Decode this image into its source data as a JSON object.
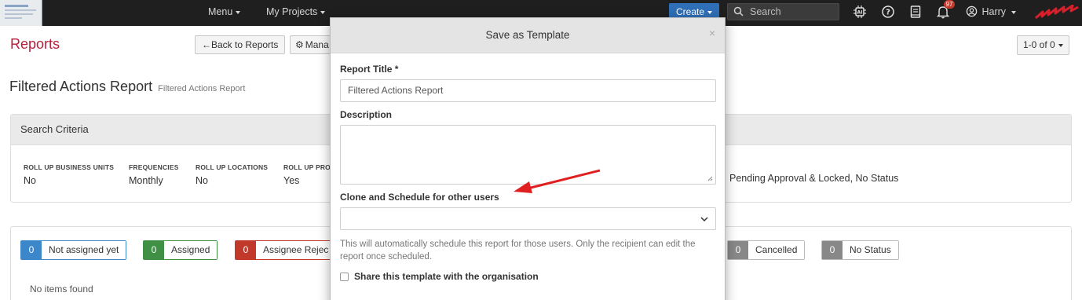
{
  "navbar": {
    "menu_label": "Menu",
    "projects_label": "My Projects",
    "create_label": "Create",
    "search_placeholder": "Search",
    "notifications_count": "97",
    "user_name": "Harry",
    "icons": [
      "cpu-icon",
      "help-icon",
      "book-icon",
      "bell-icon",
      "user-circle-icon"
    ]
  },
  "header": {
    "title": "Reports",
    "back_label": "Back to Reports",
    "manage_label": "Mana",
    "pager_label": "1-0 of 0"
  },
  "report": {
    "title": "Filtered Actions Report",
    "subtitle": "Filtered Actions Report"
  },
  "criteria": {
    "heading": "Search Criteria",
    "items": [
      {
        "label": "ROLL UP BUSINESS UNITS",
        "value": "No"
      },
      {
        "label": "FREQUENCIES",
        "value": "Monthly"
      },
      {
        "label": "ROLL UP LOCATIONS",
        "value": "No"
      },
      {
        "label": "ROLL UP PRO",
        "value": "Yes"
      }
    ],
    "status_value": "Pending Approval & Locked, No Status"
  },
  "statuses": [
    {
      "count": "0",
      "label": "Not assigned yet",
      "color": "#3c87c9"
    },
    {
      "count": "0",
      "label": "Assigned",
      "color": "#3f8f45"
    },
    {
      "count": "0",
      "label": "Assignee Rejec",
      "color": "#c0392b"
    },
    {
      "count": "0",
      "label": "Cancelled",
      "color": "#888888"
    },
    {
      "count": "0",
      "label": "No Status",
      "color": "#888888"
    }
  ],
  "empty_message": "No items found",
  "modal": {
    "title": "Save as Template",
    "close_symbol": "×",
    "report_title_label": "Report Title *",
    "report_title_value": "Filtered Actions Report",
    "description_label": "Description",
    "description_value": "",
    "clone_label": "Clone and Schedule for other users",
    "clone_value": "",
    "help_text": "This will automatically schedule this report for those users. Only the recipient can edit the report once scheduled.",
    "share_label": "Share this template with the organisation",
    "share_checked": false
  },
  "colors": {
    "accent": "#b5203a",
    "create_button": "#2f6fb7",
    "arrow": "#e02020"
  }
}
